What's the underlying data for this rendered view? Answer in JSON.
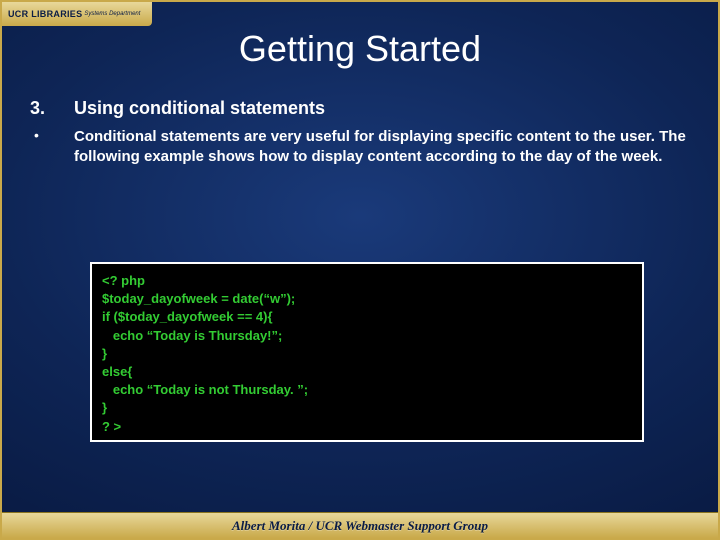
{
  "logo": {
    "main": "UCR LIBRARIES",
    "sub": "Systems Department"
  },
  "title": "Getting Started",
  "item": {
    "number": "3.",
    "subtitle": "Using conditional statements",
    "bullet": "•",
    "description": "Conditional statements are very useful for displaying specific content to the user. The following example shows how to display content according to the day of the week."
  },
  "code": "<? php\n$today_dayofweek = date(“w”);\nif ($today_dayofweek == 4){\n   echo “Today is Thursday!”;\n}\nelse{\n   echo “Today is not Thursday. ”;\n}\n? >",
  "footer": "Albert Morita / UCR Webmaster Support Group"
}
